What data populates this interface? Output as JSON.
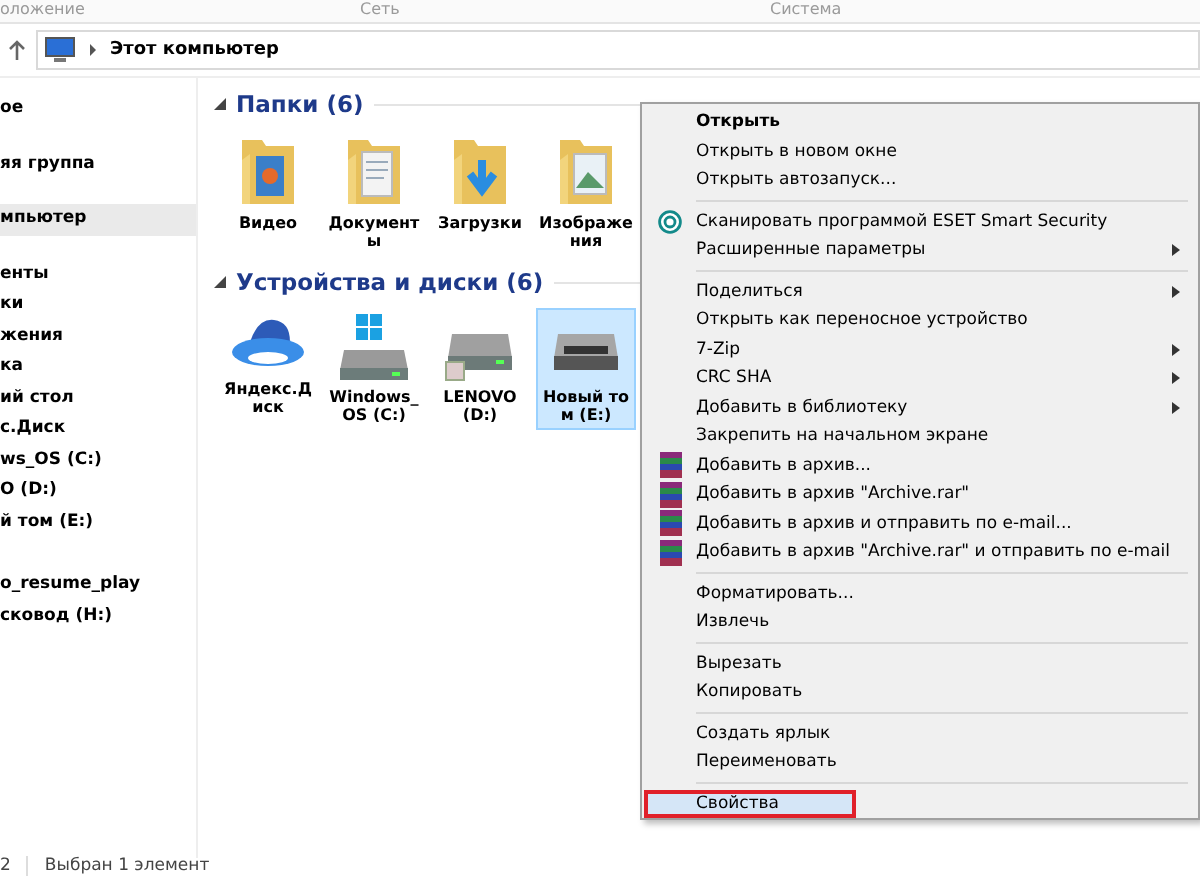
{
  "ribbon_groups": [
    "оложение",
    "Сеть",
    "Система"
  ],
  "address_bar": {
    "path": "Этот компьютер"
  },
  "navigation": [
    {
      "label": "ое",
      "selected": false
    },
    {
      "label": "яя группа",
      "selected": false
    },
    {
      "label": "мпьютер",
      "selected": true
    },
    {
      "label": "енты",
      "selected": false
    },
    {
      "label": "ки",
      "selected": false
    },
    {
      "label": "жения",
      "selected": false
    },
    {
      "label": "ка",
      "selected": false
    },
    {
      "label": "ий стол",
      "selected": false
    },
    {
      "label": "с.Диск",
      "selected": false
    },
    {
      "label": "ws_OS (C:)",
      "selected": false
    },
    {
      "label": "O (D:)",
      "selected": false
    },
    {
      "label": "й том (E:)",
      "selected": false
    },
    {
      "label": "o_resume_play",
      "selected": false
    },
    {
      "label": "сковод (H:)",
      "selected": false
    }
  ],
  "sections": [
    {
      "title": "Папки (6)",
      "items": [
        {
          "kind": "folder-video",
          "label": "Видео",
          "selected": false
        },
        {
          "kind": "folder-documents",
          "label": "Документы",
          "selected": false
        },
        {
          "kind": "folder-downloads",
          "label": "Загрузки",
          "selected": false
        },
        {
          "kind": "folder-pictures",
          "label": "Изображения",
          "selected": false
        }
      ]
    },
    {
      "title": "Устройства и диски (6)",
      "items": [
        {
          "kind": "cloud",
          "label": "Яндекс.Диск",
          "selected": false
        },
        {
          "kind": "system-drive",
          "label": "Windows_ OS (C:)",
          "selected": false
        },
        {
          "kind": "drive",
          "label": "LENOVO (D:)",
          "selected": false
        },
        {
          "kind": "removable",
          "label": "Новый том (E:)",
          "selected": true
        }
      ]
    }
  ],
  "status_bar": {
    "count": "2",
    "selection": "Выбран 1 элемент"
  },
  "context_menu": {
    "groups": [
      [
        {
          "label": "Открыть",
          "default": true,
          "submenu": false,
          "selected": false
        },
        {
          "label": "Открыть в новом окне",
          "default": false,
          "submenu": false,
          "selected": false
        },
        {
          "label": "Открыть автозапуск...",
          "default": false,
          "submenu": false,
          "selected": false
        }
      ],
      [
        {
          "label": "Сканировать программой ESET Smart Security",
          "kind": "scan",
          "default": false,
          "submenu": false,
          "selected": false
        },
        {
          "label": "Расширенные параметры",
          "default": false,
          "submenu": true,
          "selected": false
        }
      ],
      [
        {
          "label": "Поделиться",
          "default": false,
          "submenu": true,
          "selected": false
        },
        {
          "label": "Открыть как переносное устройство",
          "default": false,
          "submenu": false,
          "selected": false
        },
        {
          "label": "7-Zip",
          "default": false,
          "submenu": true,
          "selected": false
        },
        {
          "label": "CRC SHA",
          "default": false,
          "submenu": true,
          "selected": false
        },
        {
          "label": "Добавить в библиотеку",
          "default": false,
          "submenu": true,
          "selected": false
        },
        {
          "label": "Закрепить на начальном экране",
          "default": false,
          "submenu": false,
          "selected": false
        },
        {
          "label": "Добавить в архив...",
          "kind": "archive",
          "default": false,
          "submenu": false,
          "selected": false
        },
        {
          "label": "Добавить в архив \"Archive.rar\"",
          "kind": "archive",
          "default": false,
          "submenu": false,
          "selected": false
        },
        {
          "label": "Добавить в архив и отправить по e-mail...",
          "kind": "archive",
          "default": false,
          "submenu": false,
          "selected": false
        },
        {
          "label": "Добавить в архив \"Archive.rar\" и отправить по e-mail",
          "kind": "archive",
          "default": false,
          "submenu": false,
          "selected": false
        }
      ],
      [
        {
          "label": "Форматировать...",
          "default": false,
          "submenu": false,
          "selected": false
        },
        {
          "label": "Извлечь",
          "default": false,
          "submenu": false,
          "selected": false
        }
      ],
      [
        {
          "label": "Вырезать",
          "default": false,
          "submenu": false,
          "selected": false
        },
        {
          "label": "Копировать",
          "default": false,
          "submenu": false,
          "selected": false
        }
      ],
      [
        {
          "label": "Создать ярлык",
          "default": false,
          "submenu": false,
          "selected": false
        },
        {
          "label": "Переименовать",
          "default": false,
          "submenu": false,
          "selected": false
        }
      ],
      [
        {
          "label": "Свойства",
          "default": false,
          "submenu": false,
          "selected": true
        }
      ]
    ]
  }
}
